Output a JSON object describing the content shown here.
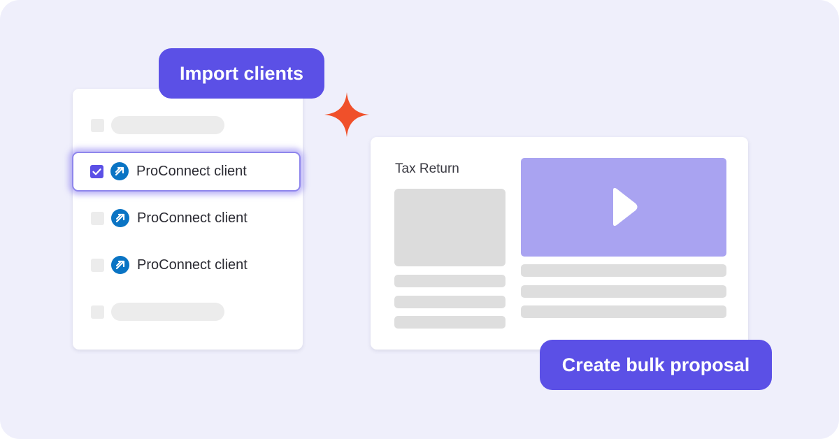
{
  "callouts": {
    "import_label": "Import clients",
    "bulk_label": "Create bulk proposal"
  },
  "client_list": {
    "rows": [
      {
        "type": "placeholder",
        "checked": false
      },
      {
        "type": "client",
        "name": "ProConnect client",
        "checked": true,
        "selected": true
      },
      {
        "type": "client",
        "name": "ProConnect client",
        "checked": false
      },
      {
        "type": "client",
        "name": "ProConnect client",
        "checked": false
      },
      {
        "type": "placeholder",
        "checked": false
      }
    ]
  },
  "proposal": {
    "document_title": "Tax Return",
    "icons": [
      "play-icon"
    ]
  },
  "icons": {
    "sparkle": "sparkle-icon",
    "client_logo": "proconnect-logo-icon",
    "checkmark": "checkmark-icon"
  },
  "colors": {
    "background": "#efeffb",
    "accent": "#5b50e6",
    "video_block": "#a9a3f1",
    "sparkle": "#f0502a",
    "proconnect_logo": "#0a74c4",
    "placeholder": "#ececec"
  }
}
